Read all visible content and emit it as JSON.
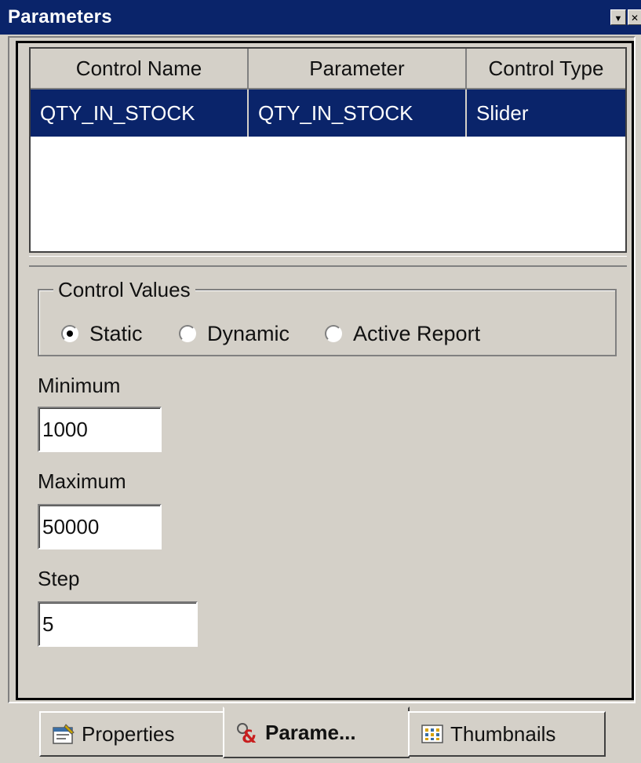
{
  "window": {
    "title": "Parameters",
    "pin_glyph": "▼",
    "close_glyph": "✕"
  },
  "grid": {
    "columns": [
      "Control Name",
      "Parameter",
      "Control Type"
    ],
    "rows": [
      {
        "control_name": "QTY_IN_STOCK",
        "parameter": "QTY_IN_STOCK",
        "control_type": "Slider",
        "selected": true
      }
    ]
  },
  "control_values": {
    "legend": "Control Values",
    "options": [
      "Static",
      "Dynamic",
      "Active Report"
    ],
    "selected": "Static"
  },
  "fields": {
    "minimum_label": "Minimum",
    "minimum_value": "1000",
    "maximum_label": "Maximum",
    "maximum_value": "50000",
    "step_label": "Step",
    "step_value": "5"
  },
  "tabs": [
    {
      "label": "Properties",
      "icon": "properties-icon",
      "active": false
    },
    {
      "label": "Parame...",
      "icon": "parameters-icon",
      "active": true
    },
    {
      "label": "Thumbnails",
      "icon": "thumbnails-icon",
      "active": false
    }
  ],
  "colors": {
    "selection": "#0a246a",
    "face": "#d4d0c8"
  }
}
